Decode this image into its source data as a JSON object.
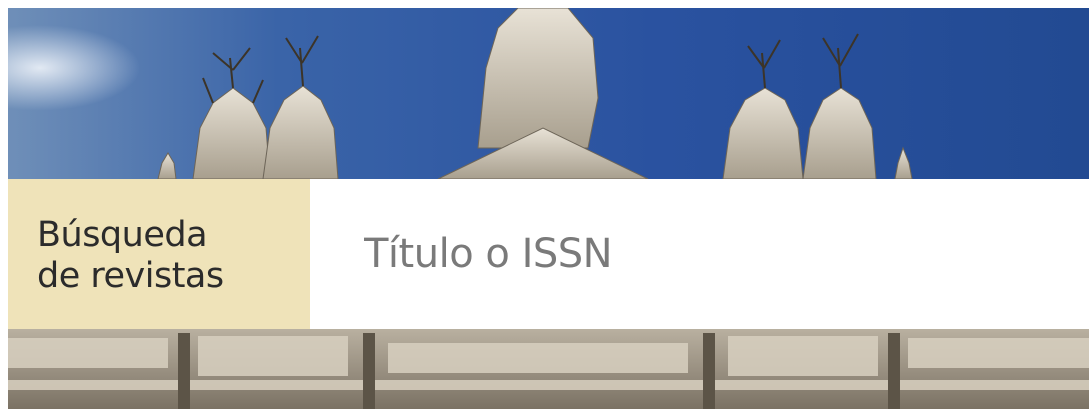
{
  "search_section": {
    "label_line1": "Búsqueda",
    "label_line2": "de revistas",
    "input_placeholder": "Título o ISSN",
    "input_value": ""
  },
  "colors": {
    "label_panel_bg": "#efe3b9",
    "sky_top": "#23468c",
    "sky_bottom": "#3b6fb5",
    "stone": "#d9d2c3",
    "search_bg": "#ffffff",
    "placeholder_text": "#7a7a7a"
  },
  "icons": {
    "hero_image": "cathedral-facade-image"
  }
}
